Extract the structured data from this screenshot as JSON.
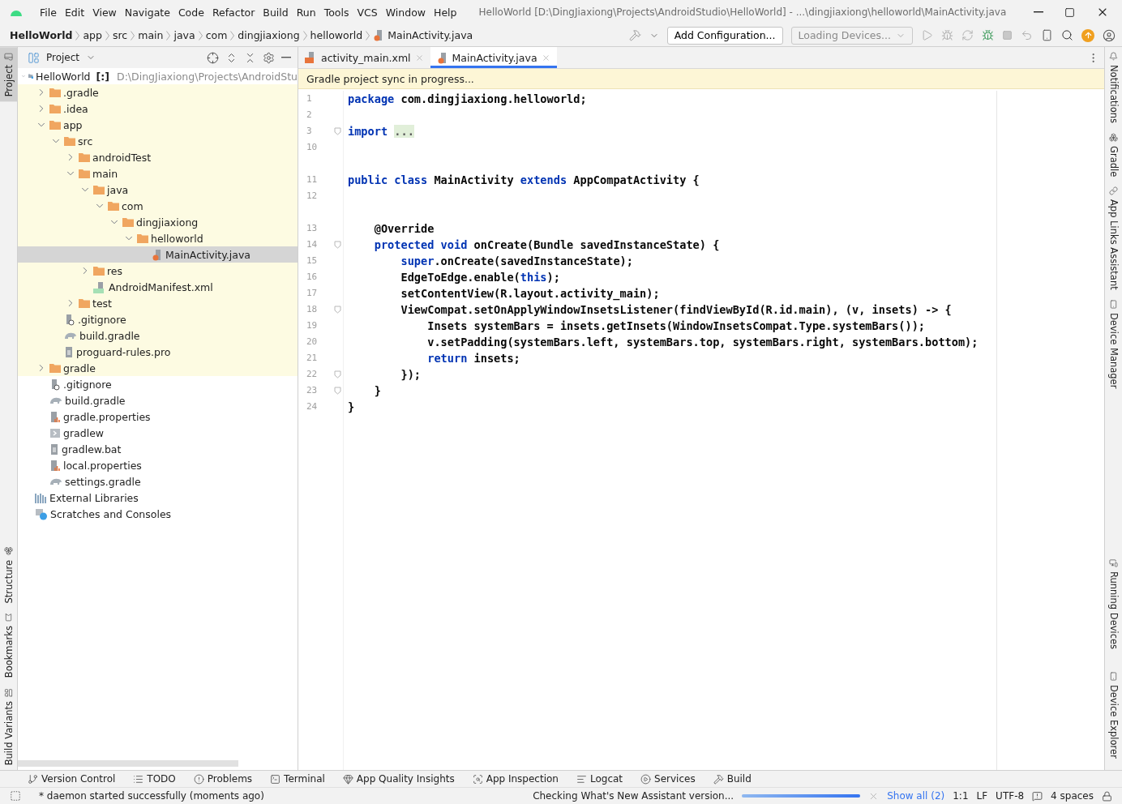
{
  "menu": [
    "File",
    "Edit",
    "View",
    "Navigate",
    "Code",
    "Refactor",
    "Build",
    "Run",
    "Tools",
    "VCS",
    "Window",
    "Help"
  ],
  "title": "HelloWorld [D:\\DingJiaxiong\\Projects\\AndroidStudio\\HelloWorld] - ...\\dingjiaxiong\\helloworld\\MainActivity.java",
  "breadcrumb": [
    {
      "label": "HelloWorld",
      "kind": "project"
    },
    {
      "label": "app",
      "kind": "dir"
    },
    {
      "label": "src",
      "kind": "dir"
    },
    {
      "label": "main",
      "kind": "dir"
    },
    {
      "label": "java",
      "kind": "dir"
    },
    {
      "label": "com",
      "kind": "dir"
    },
    {
      "label": "dingjiaxiong",
      "kind": "dir"
    },
    {
      "label": "helloworld",
      "kind": "dir"
    },
    {
      "label": "MainActivity.java",
      "kind": "file"
    }
  ],
  "toolbar": {
    "configuration": "Add Configuration...",
    "devices": "Loading Devices..."
  },
  "left_strip": {
    "top": [
      {
        "label": "Project",
        "selected": true
      }
    ],
    "bottom": [
      {
        "label": "Structure",
        "selected": false
      },
      {
        "label": "Bookmarks",
        "selected": false
      },
      {
        "label": "Build Variants",
        "selected": false
      }
    ]
  },
  "project_panel": {
    "title": "Project",
    "tree": [
      {
        "name": "HelloWorld",
        "suffix": "[:]",
        "path": "D:\\DingJiaxiong\\Projects\\AndroidStu",
        "kind": "module",
        "expanded": true,
        "selected": false,
        "highlighted": false,
        "children": [
          {
            "name": ".gradle",
            "kind": "folder",
            "expanded": false,
            "selected": false,
            "highlighted": true
          },
          {
            "name": ".idea",
            "kind": "folder",
            "expanded": false,
            "selected": false,
            "highlighted": true
          },
          {
            "name": "app",
            "kind": "folder",
            "expanded": true,
            "selected": false,
            "highlighted": true,
            "children": [
              {
                "name": "src",
                "kind": "folder",
                "expanded": true,
                "selected": false,
                "highlighted": true,
                "children": [
                  {
                    "name": "androidTest",
                    "kind": "folder",
                    "expanded": false,
                    "selected": false,
                    "highlighted": true
                  },
                  {
                    "name": "main",
                    "kind": "folder",
                    "expanded": true,
                    "selected": false,
                    "highlighted": true,
                    "children": [
                      {
                        "name": "java",
                        "kind": "folder",
                        "expanded": true,
                        "selected": false,
                        "highlighted": true,
                        "children": [
                          {
                            "name": "com",
                            "kind": "folder",
                            "expanded": true,
                            "selected": false,
                            "highlighted": true,
                            "children": [
                              {
                                "name": "dingjiaxiong",
                                "kind": "folder",
                                "expanded": true,
                                "selected": false,
                                "highlighted": true,
                                "children": [
                                  {
                                    "name": "helloworld",
                                    "kind": "folder",
                                    "expanded": true,
                                    "selected": false,
                                    "highlighted": true,
                                    "children": [
                                      {
                                        "name": "MainActivity.java",
                                        "kind": "java",
                                        "selected": true
                                      }
                                    ]
                                  }
                                ]
                              }
                            ]
                          }
                        ]
                      },
                      {
                        "name": "res",
                        "kind": "folder",
                        "expanded": false,
                        "selected": false,
                        "highlighted": true
                      },
                      {
                        "name": "AndroidManifest.xml",
                        "kind": "manifest",
                        "selected": false,
                        "highlighted": true
                      }
                    ]
                  },
                  {
                    "name": "test",
                    "kind": "folder",
                    "expanded": false,
                    "selected": false,
                    "highlighted": true
                  }
                ]
              },
              {
                "name": ".gitignore",
                "kind": "ignore",
                "selected": false,
                "highlighted": true
              },
              {
                "name": "build.gradle",
                "kind": "gradle",
                "selected": false,
                "highlighted": true
              },
              {
                "name": "proguard-rules.pro",
                "kind": "text",
                "selected": false,
                "highlighted": true
              }
            ]
          },
          {
            "name": "gradle",
            "kind": "folder",
            "expanded": false,
            "selected": false,
            "highlighted": true
          },
          {
            "name": ".gitignore",
            "kind": "ignore",
            "selected": false,
            "highlighted": false
          },
          {
            "name": "build.gradle",
            "kind": "gradle",
            "selected": false,
            "highlighted": false
          },
          {
            "name": "gradle.properties",
            "kind": "props",
            "selected": false,
            "highlighted": false
          },
          {
            "name": "gradlew",
            "kind": "shell",
            "selected": false,
            "highlighted": false
          },
          {
            "name": "gradlew.bat",
            "kind": "text",
            "selected": false,
            "highlighted": false
          },
          {
            "name": "local.properties",
            "kind": "props",
            "selected": false,
            "highlighted": false
          },
          {
            "name": "settings.gradle",
            "kind": "gradle",
            "selected": false,
            "highlighted": false
          }
        ]
      },
      {
        "name": "External Libraries",
        "kind": "libs",
        "selected": false,
        "highlighted": false
      },
      {
        "name": "Scratches and Consoles",
        "kind": "scratch",
        "selected": false,
        "highlighted": false
      }
    ]
  },
  "editor_tabs": [
    {
      "label": "activity_main.xml",
      "kind": "xml",
      "selected": false
    },
    {
      "label": "MainActivity.java",
      "kind": "java",
      "selected": true
    }
  ],
  "banner": "Gradle project sync in progress...",
  "code": [
    {
      "number": "1",
      "fold": false,
      "tokens": [
        {
          "t": "package",
          "keyword": true,
          "folded": false
        },
        {
          "t": " com.dingjiaxiong.helloworld;",
          "keyword": false,
          "folded": false
        }
      ]
    },
    {
      "number": "2",
      "fold": false
    },
    {
      "number": "3",
      "fold": true,
      "tokens": [
        {
          "t": "import ",
          "keyword": true,
          "folded": false
        },
        {
          "t": "...",
          "keyword": false,
          "folded": true
        }
      ]
    },
    {
      "number": "10",
      "fold": false,
      "gap_after": true
    },
    {
      "number": "11",
      "fold": false,
      "tokens": [
        {
          "t": "public class",
          "keyword": true,
          "folded": false
        },
        {
          "t": " MainActivity ",
          "keyword": false,
          "folded": false
        },
        {
          "t": "extends",
          "keyword": true,
          "folded": false
        },
        {
          "t": " AppCompatActivity {",
          "keyword": false,
          "folded": false
        }
      ]
    },
    {
      "number": "12",
      "fold": false,
      "gap_after": true
    },
    {
      "number": "13",
      "fold": false,
      "tokens": [
        {
          "t": "    @Override",
          "keyword": false,
          "folded": false
        }
      ]
    },
    {
      "number": "14",
      "fold": true,
      "tokens": [
        {
          "t": "    protected void",
          "keyword": true,
          "folded": false
        },
        {
          "t": " onCreate(Bundle savedInstanceState) {",
          "keyword": false,
          "folded": false
        }
      ]
    },
    {
      "number": "15",
      "fold": false,
      "tokens": [
        {
          "t": "        super",
          "keyword": true,
          "folded": false
        },
        {
          "t": ".onCreate(savedInstanceState);",
          "keyword": false,
          "folded": false
        }
      ]
    },
    {
      "number": "16",
      "fold": false,
      "tokens": [
        {
          "t": "        EdgeToEdge.enable(",
          "keyword": false,
          "folded": false
        },
        {
          "t": "this",
          "keyword": true,
          "folded": false
        },
        {
          "t": ");",
          "keyword": false,
          "folded": false
        }
      ]
    },
    {
      "number": "17",
      "fold": false,
      "tokens": [
        {
          "t": "        setContentView(R.layout.activity_main);",
          "keyword": false,
          "folded": false
        }
      ]
    },
    {
      "number": "18",
      "fold": true,
      "tokens": [
        {
          "t": "        ViewCompat.setOnApplyWindowInsetsListener(findViewById(R.id.main), (v, insets) -> {",
          "keyword": false,
          "folded": false
        }
      ]
    },
    {
      "number": "19",
      "fold": false,
      "tokens": [
        {
          "t": "            Insets systemBars = insets.getInsets(WindowInsetsCompat.Type.systemBars());",
          "keyword": false,
          "folded": false
        }
      ]
    },
    {
      "number": "20",
      "fold": false,
      "tokens": [
        {
          "t": "            v.setPadding(systemBars.left, systemBars.top, systemBars.right, systemBars.bottom);",
          "keyword": false,
          "folded": false
        }
      ]
    },
    {
      "number": "21",
      "fold": false,
      "tokens": [
        {
          "t": "            return",
          "keyword": true,
          "folded": false
        },
        {
          "t": " insets;",
          "keyword": false,
          "folded": false
        }
      ]
    },
    {
      "number": "22",
      "fold": true,
      "tokens": [
        {
          "t": "        });",
          "keyword": false,
          "folded": false
        }
      ]
    },
    {
      "number": "23",
      "fold": true,
      "tokens": [
        {
          "t": "    }",
          "keyword": false,
          "folded": false
        }
      ]
    },
    {
      "number": "24",
      "fold": false,
      "tokens": [
        {
          "t": "}",
          "keyword": false,
          "folded": false
        }
      ]
    }
  ],
  "right_strip": {
    "top": [
      {
        "label": "Notifications",
        "kind": "bell"
      },
      {
        "label": "Gradle",
        "kind": "gradle"
      },
      {
        "label": "App Links Assistant",
        "kind": "link"
      },
      {
        "label": "Device Manager",
        "kind": "device"
      }
    ],
    "bottom": [
      {
        "label": "Running Devices",
        "kind": "screen"
      },
      {
        "label": "Device Explorer",
        "kind": "device"
      }
    ]
  },
  "tool_tabs": [
    {
      "label": "Version Control",
      "kind": "branch"
    },
    {
      "label": "TODO",
      "kind": "list"
    },
    {
      "label": "Problems",
      "kind": "alert"
    },
    {
      "label": "Terminal",
      "kind": "terminal"
    },
    {
      "label": "App Quality Insights",
      "kind": "gem"
    },
    {
      "label": "App Inspection",
      "kind": "inspect"
    },
    {
      "label": "Logcat",
      "kind": "lines"
    },
    {
      "label": "Services",
      "kind": "play"
    },
    {
      "label": "Build",
      "kind": "hammer"
    }
  ],
  "status": {
    "message": "* daemon started successfully (moments ago)",
    "task": "Checking What's New Assistant version...",
    "progress": {
      "level": 1
    },
    "show_all": "Show all (2)",
    "position": "1:1",
    "line_ending": "LF",
    "encoding": "UTF-8",
    "indent": "4 spaces"
  }
}
